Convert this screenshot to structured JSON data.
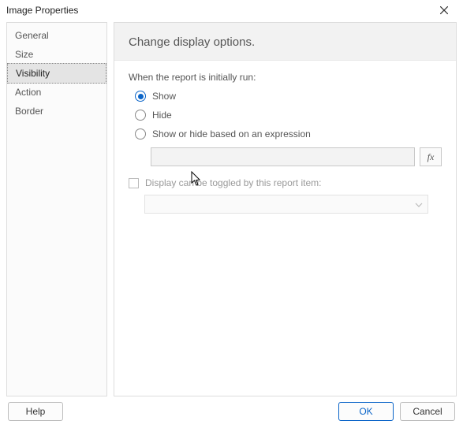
{
  "window": {
    "title": "Image Properties"
  },
  "sidebar": {
    "items": [
      {
        "label": "General",
        "selected": false
      },
      {
        "label": "Size",
        "selected": false
      },
      {
        "label": "Visibility",
        "selected": true
      },
      {
        "label": "Action",
        "selected": false
      },
      {
        "label": "Border",
        "selected": false
      }
    ]
  },
  "content": {
    "heading": "Change display options.",
    "section_label": "When the report is initially run:",
    "radios": [
      {
        "label": "Show",
        "selected": true
      },
      {
        "label": "Hide",
        "selected": false
      },
      {
        "label": "Show or hide based on an expression",
        "selected": false
      }
    ],
    "expression_value": "",
    "fx_label": "fx",
    "toggle_checkbox": {
      "checked": false,
      "label": "Display can be toggled by this report item:"
    },
    "toggle_dropdown_value": ""
  },
  "footer": {
    "help_label": "Help",
    "ok_label": "OK",
    "cancel_label": "Cancel"
  }
}
